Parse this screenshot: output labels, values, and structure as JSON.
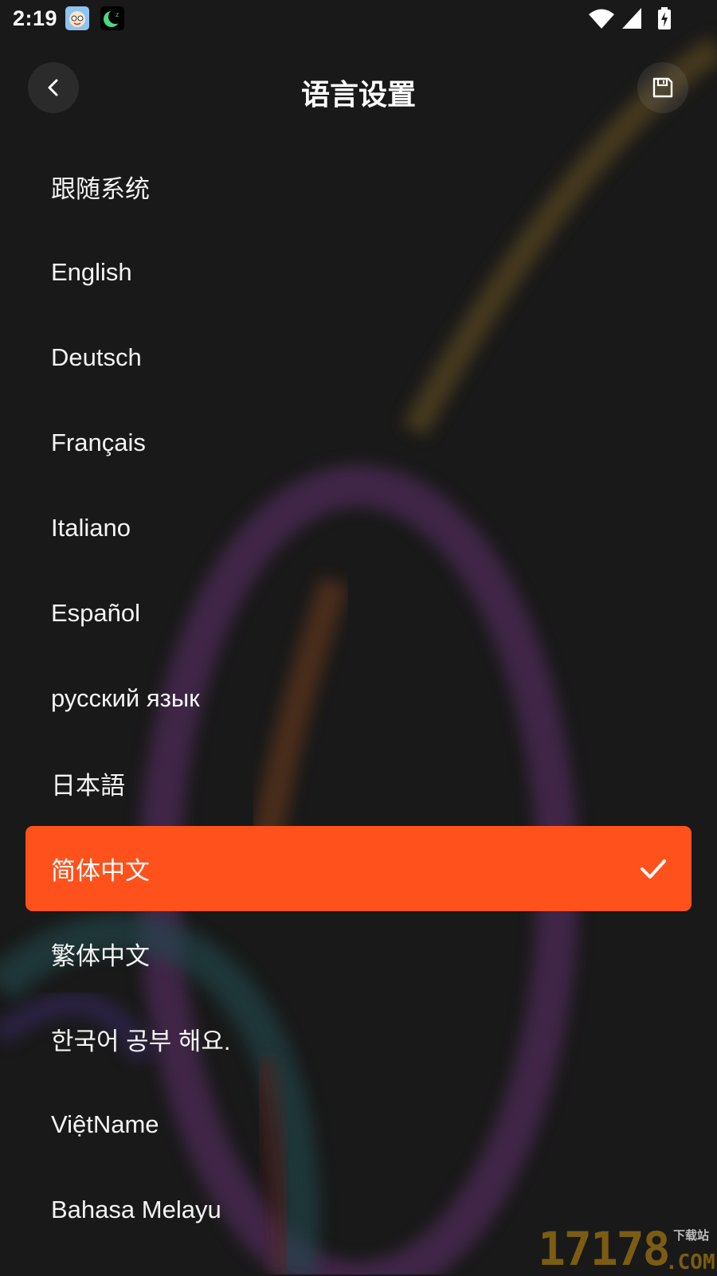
{
  "status_bar": {
    "time": "2:19",
    "icons": [
      "baby-app-icon",
      "moon-sleep-app-icon",
      "wifi-icon",
      "signal-icon",
      "battery-charging-icon"
    ]
  },
  "header": {
    "title": "语言设置",
    "back_icon": "chevron-left-icon",
    "save_icon": "floppy-disk-icon"
  },
  "languages": [
    {
      "label": "跟随系统",
      "selected": false
    },
    {
      "label": "English",
      "selected": false
    },
    {
      "label": "Deutsch",
      "selected": false
    },
    {
      "label": "Français",
      "selected": false
    },
    {
      "label": "Italiano",
      "selected": false
    },
    {
      "label": "Español",
      "selected": false
    },
    {
      "label": "русский язык",
      "selected": false
    },
    {
      "label": "日本語",
      "selected": false
    },
    {
      "label": "简体中文",
      "selected": true
    },
    {
      "label": "繁体中文",
      "selected": false
    },
    {
      "label": "한국어 공부 해요.",
      "selected": false
    },
    {
      "label": "ViệtName",
      "selected": false
    },
    {
      "label": "Bahasa Melayu",
      "selected": false
    }
  ],
  "selected_check_icon": "checkmark-icon",
  "colors": {
    "background": "#191919",
    "accent": "#ff511c",
    "text": "#ffffff"
  },
  "watermark": {
    "number": "17178",
    "label": "下载站",
    "suffix": ".COM"
  }
}
